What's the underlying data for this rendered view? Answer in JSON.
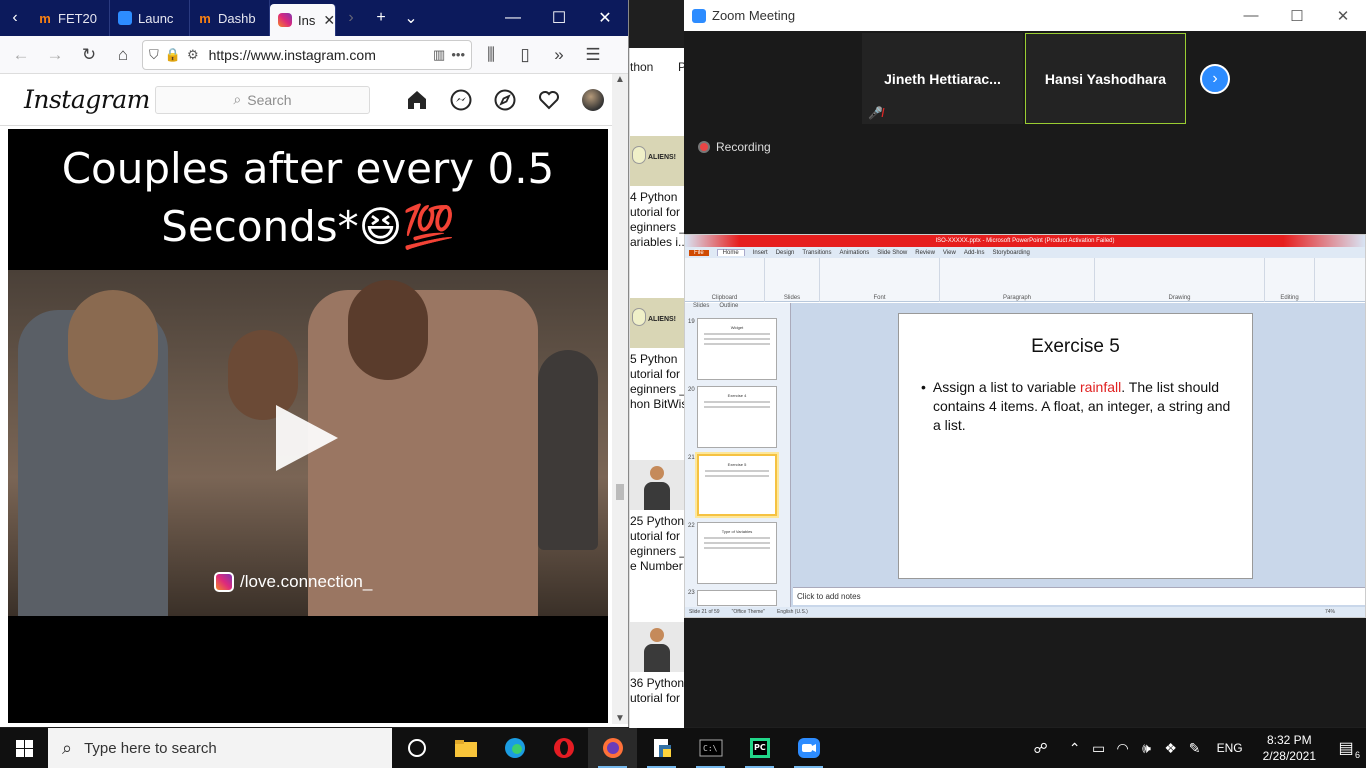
{
  "firefox": {
    "tabs": [
      {
        "label": "FET20",
        "icon": "moodle-icon"
      },
      {
        "label": "Launc",
        "icon": "zoom-icon"
      },
      {
        "label": "Dashb",
        "icon": "moodle-icon"
      },
      {
        "label": "Ins",
        "icon": "instagram-icon",
        "active": true
      }
    ],
    "close_glyph": "✕",
    "url": "https://www.instagram.com"
  },
  "instagram": {
    "logo": "Instagram",
    "search_placeholder": "Search",
    "post_caption_line1": "Couples after every 0.5",
    "post_caption_line2": "Seconds*😆💯",
    "watermark": "/love.connection_"
  },
  "youtube_strip": {
    "breadcrumb": "thon",
    "breadcrumb2": "P",
    "items": [
      {
        "title": "4 Python\nutorial for\neginners _\nariables i...",
        "thumb": "aliens"
      },
      {
        "title": "5 Python\nutorial for\neginners _\nhon BitWis",
        "thumb": "aliens"
      },
      {
        "title": "25 Python\nutorial for\neginners _\ne Number",
        "thumb": "person"
      },
      {
        "title": "36 Python\nutorial for",
        "thumb": "person"
      }
    ],
    "aliens_text": "ALIENS!"
  },
  "zoom": {
    "window_title": "Zoom Meeting",
    "participants": [
      {
        "name": "Jineth  Hettiarac...",
        "muted": true
      },
      {
        "name": "Hansi Yashodhara",
        "muted": false
      }
    ],
    "recording_label": "Recording"
  },
  "powerpoint": {
    "title": "ISO-XXXXX.pptx - Microsoft PowerPoint (Product Activation Failed)",
    "tabs": [
      "File",
      "Home",
      "Insert",
      "Design",
      "Transitions",
      "Animations",
      "Slide Show",
      "Review",
      "View",
      "Add-Ins",
      "Storyboarding"
    ],
    "ribbon_groups": [
      "Clipboard",
      "Slides",
      "Font",
      "Paragraph",
      "Drawing",
      "Editing"
    ],
    "pane_tabs": [
      "Slides",
      "Outline"
    ],
    "thumbs": [
      {
        "num": "19",
        "title": "Widget"
      },
      {
        "num": "20",
        "title": "Exercise 4"
      },
      {
        "num": "21",
        "title": "Exercise 5"
      },
      {
        "num": "22",
        "title": "Type of Variables"
      },
      {
        "num": "23",
        "title": ""
      }
    ],
    "slide_title": "Exercise 5",
    "bullet_pre": "Assign a list to variable ",
    "bullet_highlight": "rainfall",
    "bullet_post": ". The list should contains 4 items. A float, an integer, a string and a list.",
    "notes_placeholder": "Click to add notes",
    "status": [
      "Slide 21 of 59",
      "\"Office Theme\"",
      "English (U.S.)"
    ],
    "zoom_level": "74%"
  },
  "taskbar": {
    "search_placeholder": "Type here to search",
    "language": "ENG",
    "time": "8:32 PM",
    "date": "2/28/2021",
    "notification_count": "6"
  },
  "colors": {
    "firefox_tabbar": "#0c1a5c",
    "zoom_blue": "#2d8cff",
    "ppt_red_title": "#e61e1e",
    "speaker_border": "#9acd32",
    "highlight_red": "#e02020"
  }
}
